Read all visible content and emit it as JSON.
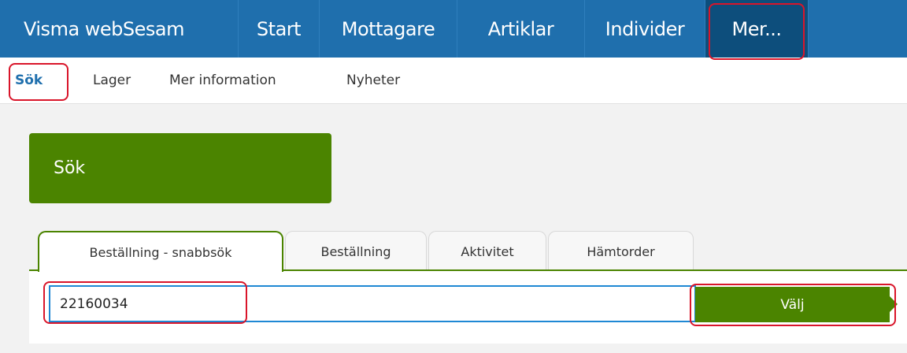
{
  "topnav": {
    "brand": "Visma webSesam",
    "items": [
      "Start",
      "Mottagare",
      "Artiklar",
      "Individer",
      "Mer..."
    ]
  },
  "subnav": {
    "items": [
      "Sök",
      "Lager",
      "Mer information",
      "Nyheter"
    ]
  },
  "page_title": "Sök",
  "tabs": [
    "Beställning - snabbsök",
    "Beställning",
    "Aktivitet",
    "Hämtorder"
  ],
  "search": {
    "value": "22160034",
    "placeholder": ""
  },
  "button": {
    "label": "Välj"
  },
  "colors": {
    "nav_bg": "#1f6fad",
    "nav_active": "#0d4e7c",
    "accent_green": "#4b8400",
    "highlight": "#d9152a"
  }
}
